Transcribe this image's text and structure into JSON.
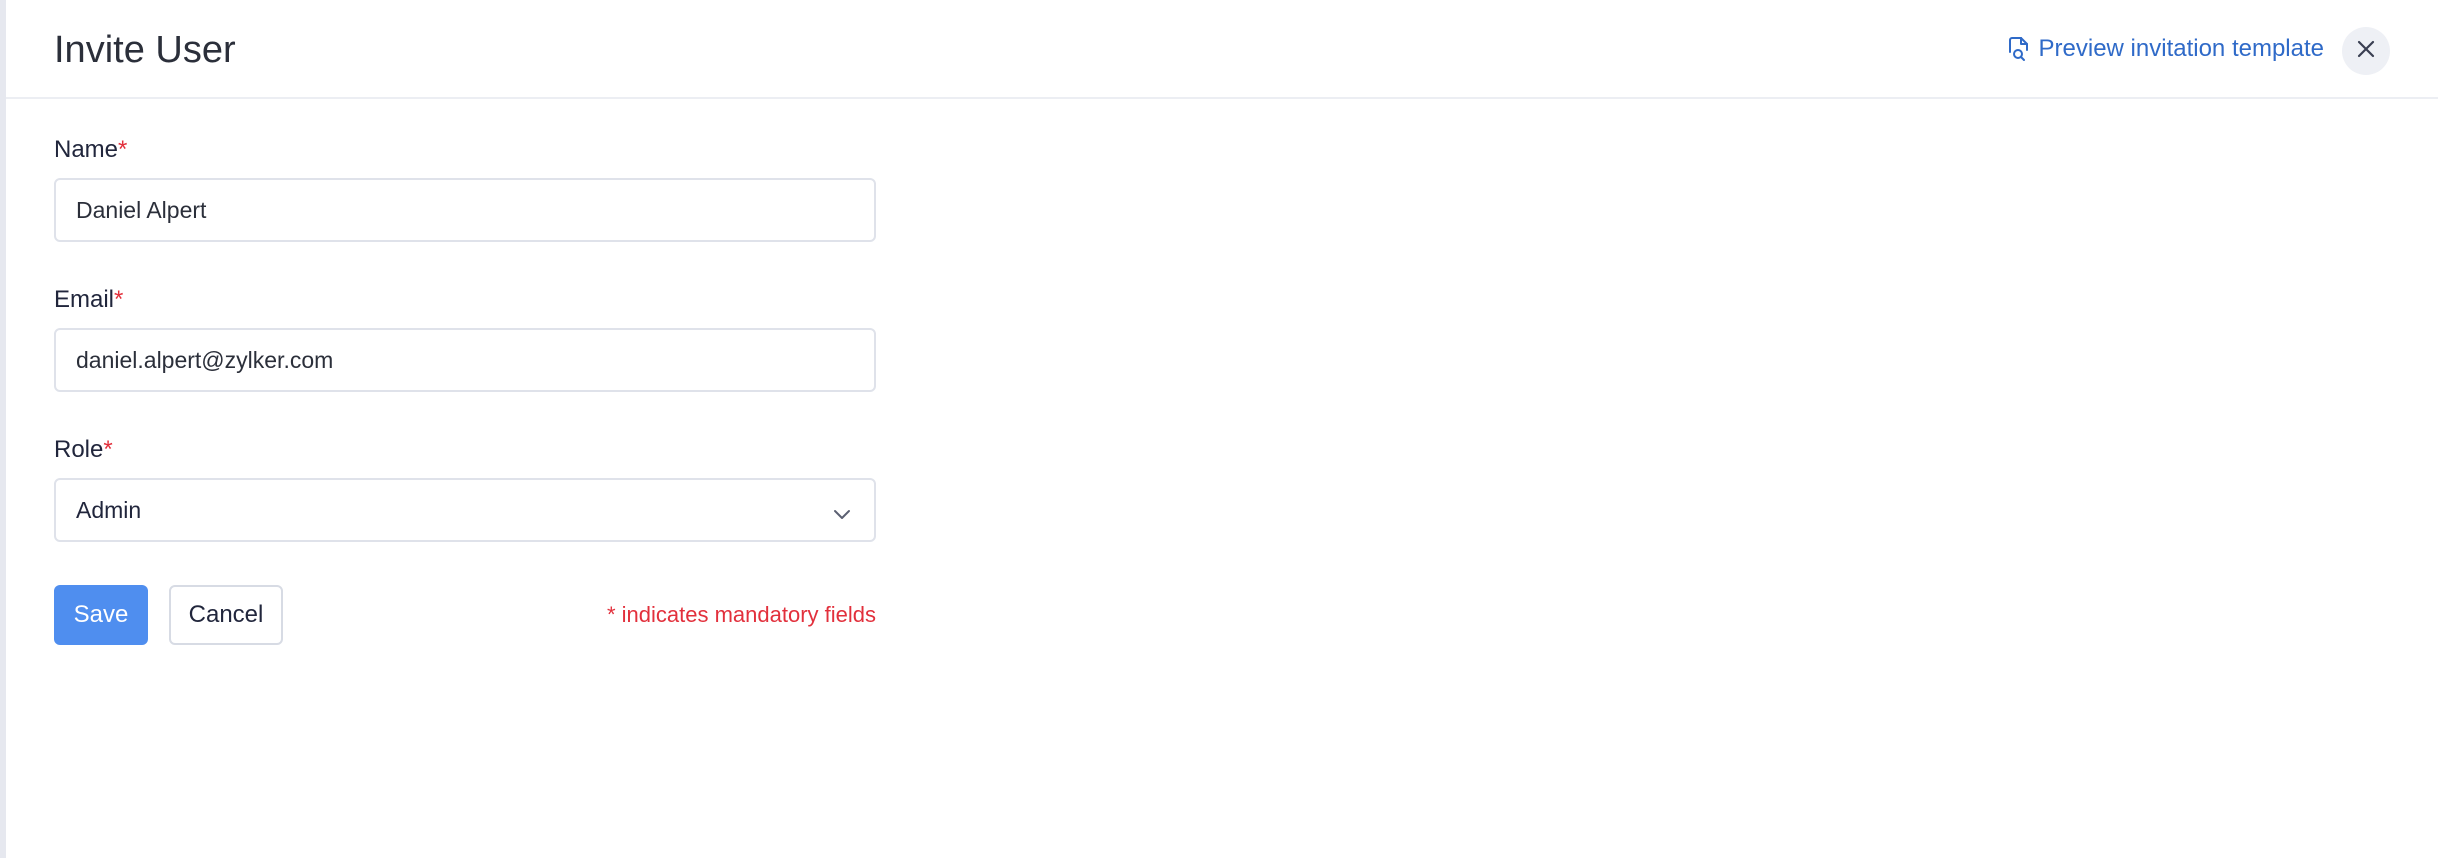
{
  "header": {
    "title": "Invite User",
    "preview_link_label": "Preview invitation template",
    "preview_icon": "document-search-icon",
    "close_icon": "close-icon"
  },
  "form": {
    "name": {
      "label": "Name",
      "required_mark": "*",
      "value": "Daniel Alpert"
    },
    "email": {
      "label": "Email",
      "required_mark": "*",
      "value": "daniel.alpert@zylker.com"
    },
    "role": {
      "label": "Role",
      "required_mark": "*",
      "selected": "Admin"
    }
  },
  "actions": {
    "save_label": "Save",
    "cancel_label": "Cancel",
    "mandatory_note": "* indicates mandatory fields"
  },
  "colors": {
    "accent": "#4f8eef",
    "link": "#2f6ac8",
    "required": "#e2303c"
  }
}
